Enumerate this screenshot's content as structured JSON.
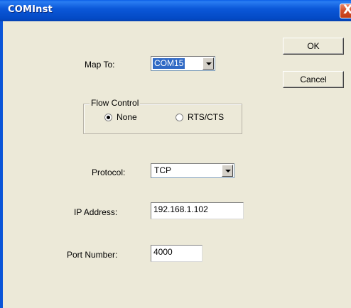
{
  "window": {
    "title": "COMInst",
    "close_glyph": "X"
  },
  "buttons": {
    "ok_label": "OK",
    "cancel_label": "Cancel"
  },
  "map_to": {
    "label": "Map To:",
    "value": "COM15"
  },
  "flow_control": {
    "legend": "Flow Control",
    "options": [
      {
        "label": "None",
        "checked": true
      },
      {
        "label": "RTS/CTS",
        "checked": false
      }
    ]
  },
  "protocol": {
    "label": "Protocol:",
    "value": "TCP"
  },
  "ip_address": {
    "label": "IP Address:",
    "value": "192.168.1.102"
  },
  "port_number": {
    "label": "Port Number:",
    "value": "4000"
  },
  "colors": {
    "title_bar": "#0b58d9",
    "dialog_bg": "#ece9d8",
    "selection": "#316ac5",
    "close_button": "#d4502c"
  },
  "icons": [
    "close-icon",
    "dropdown-arrow-icon"
  ]
}
